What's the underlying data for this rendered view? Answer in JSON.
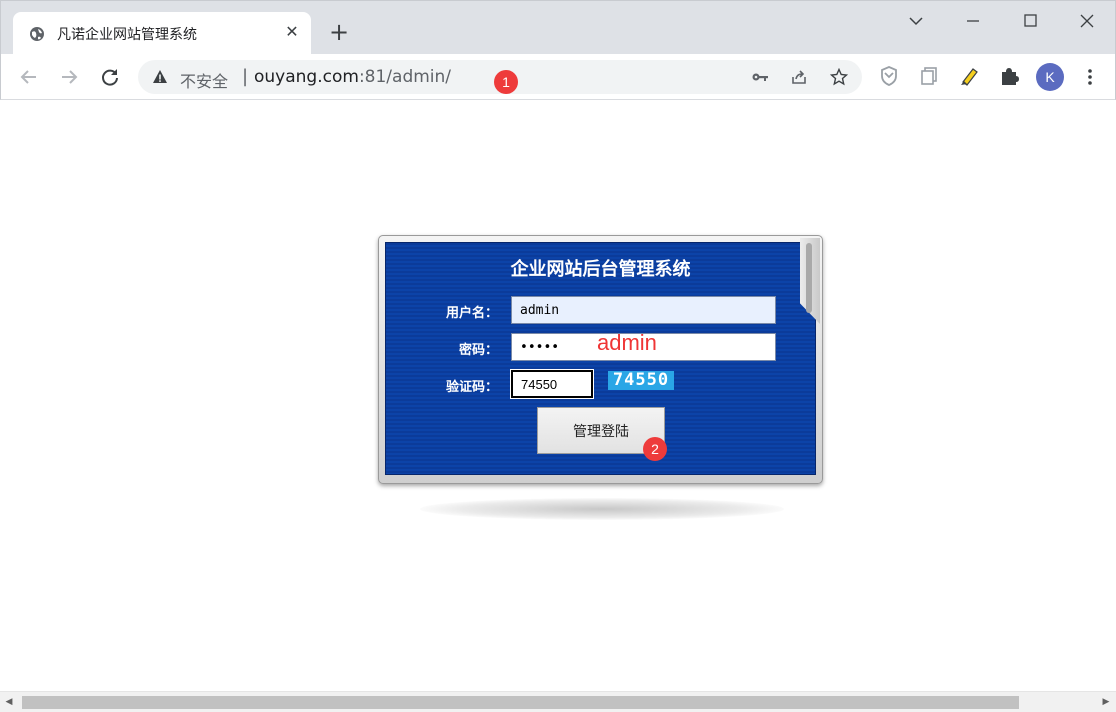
{
  "browser": {
    "tab": {
      "title": "凡诺企业网站管理系统",
      "close_label": "✕"
    },
    "new_tab_label": "+",
    "window_controls": [
      "chevron-down",
      "minimize",
      "maximize",
      "close"
    ],
    "address_bar": {
      "security_text": "不安全",
      "separator": "|",
      "url_host": "ouyang.com",
      "url_rest": ":81/admin/"
    },
    "profile_initial": "K"
  },
  "annotations": {
    "badge_1": "1",
    "badge_2": "2",
    "password_hint": "admin"
  },
  "login": {
    "title": "企业网站后台管理系统",
    "username_label": "用户名：",
    "username_value": "admin",
    "password_label": "密码：",
    "password_value": "•••••",
    "captcha_label": "验证码：",
    "captcha_value": "74550",
    "captcha_image_text": "74550",
    "submit_label": "管理登陆"
  },
  "colors": {
    "panel_blue": "#0b3b9a",
    "captcha_bg": "#2aa6e6",
    "badge_red": "#ee3b3b"
  }
}
